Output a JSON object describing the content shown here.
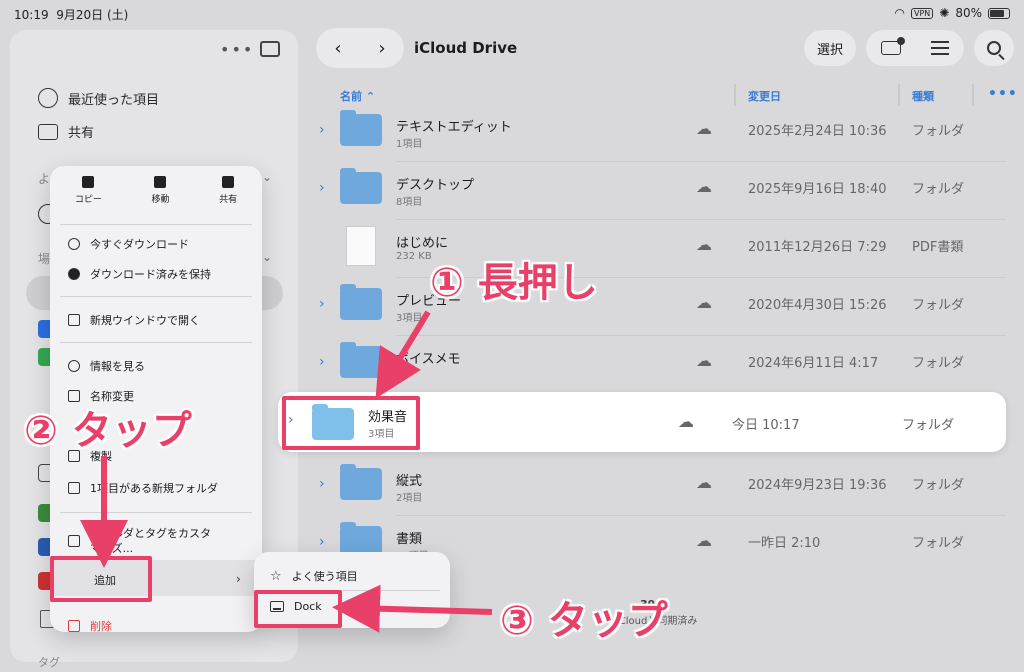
{
  "status_bar": {
    "time": "10:19",
    "date": "9月20日 (土)",
    "vpn": "VPN",
    "battery": "80%"
  },
  "sidebar": {
    "items": [
      {
        "label": "最近使った項目",
        "icon": "clock-icon"
      },
      {
        "label": "共有",
        "icon": "shared-folder-icon"
      }
    ],
    "section_labels": [
      "よ",
      "場"
    ],
    "tags_label": "タグ"
  },
  "toolbar": {
    "title": "iCloud Drive",
    "back": "‹",
    "forward": "›",
    "select_label": "選択",
    "icons": [
      "new-folder-icon",
      "list-view-icon",
      "search-icon"
    ]
  },
  "columns": {
    "name": "名前",
    "modified": "変更日",
    "kind": "種類"
  },
  "files": [
    {
      "name": "テキストエディット",
      "sub": "1項目",
      "date": "2025年2月24日 10:36",
      "kind": "フォルダ",
      "type": "folder"
    },
    {
      "name": "デスクトップ",
      "sub": "8項目",
      "date": "2025年9月16日 18:40",
      "kind": "フォルダ",
      "type": "folder"
    },
    {
      "name": "はじめに",
      "sub": "232 KB",
      "date": "2011年12月26日 7:29",
      "kind": "PDF書類",
      "type": "doc"
    },
    {
      "name": "プレビュー",
      "sub": "3項目",
      "date": "2020年4月30日 15:26",
      "kind": "フォルダ",
      "type": "folder"
    },
    {
      "name": "ボイスメモ",
      "sub": "",
      "date": "2024年6月11日 4:17",
      "kind": "フォルダ",
      "type": "folder"
    },
    {
      "name": "縦式",
      "sub": "2項目",
      "date": "2024年9月23日 19:36",
      "kind": "フォルダ",
      "type": "folder"
    },
    {
      "name": "書類",
      "sub": "23項目",
      "date": "一昨日 2:10",
      "kind": "フォルダ",
      "type": "folder"
    }
  ],
  "selected_file": {
    "name": "効果音",
    "sub": "3項目",
    "date": "今日 10:17",
    "kind": "フォルダ"
  },
  "footer": {
    "count": "39",
    "status": "iCloudと同期済み"
  },
  "context_menu": {
    "top_actions": [
      {
        "label": "コピー"
      },
      {
        "label": "移動"
      },
      {
        "label": "共有"
      }
    ],
    "items": [
      {
        "label": "今すぐダウンロード"
      },
      {
        "label": "ダウンロード済みを保持"
      },
      {
        "label": "新規ウインドウで開く"
      },
      {
        "label": "情報を見る"
      },
      {
        "label": "名称変更"
      },
      {
        "label": "複製"
      },
      {
        "label": "1項目がある新規フォルダ"
      },
      {
        "label": "フォルダとタグをカスタマイズ..."
      },
      {
        "label": "追加"
      },
      {
        "label": "削除"
      }
    ]
  },
  "submenu": {
    "items": [
      {
        "label": "よく使う項目"
      },
      {
        "label": "Dock"
      }
    ]
  },
  "annotations": {
    "step1": "① 長押し",
    "step2": "② タップ",
    "step3": "③ タップ",
    "color": "#e84068"
  }
}
